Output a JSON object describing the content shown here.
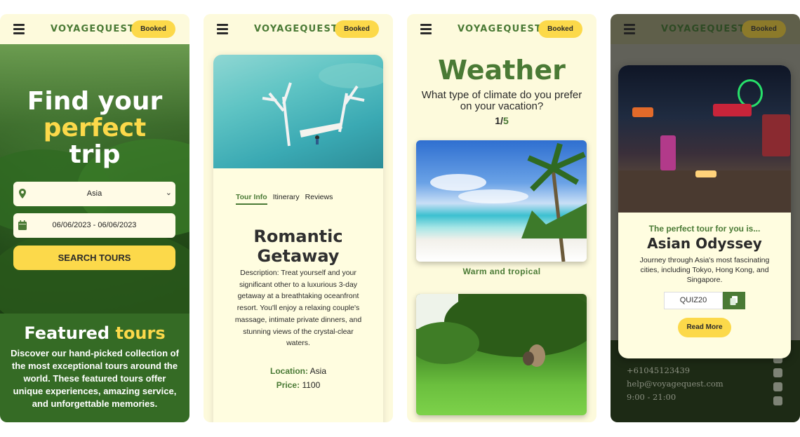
{
  "brand": {
    "logo": "VOYAGEQUEST",
    "booked_label": "Booked"
  },
  "panel1": {
    "hero_line1": "Find your",
    "hero_line2": "perfect",
    "hero_line3": "trip",
    "destination_value": "Asia",
    "date_value": "06/06/2023 - 06/06/2023",
    "search_label": "SEARCH TOURS",
    "featured_title_a": "Featured",
    "featured_title_b": "tours",
    "featured_text": "Discover our hand-picked collection of the most exceptional tours around the world. These featured tours offer unique experiences, amazing service, and unforgettable memories."
  },
  "panel2": {
    "tabs": [
      "Tour Info",
      "Itinerary",
      "Reviews"
    ],
    "title": "Romantic Getaway",
    "description": "Description: Treat yourself and your significant other to a luxurious 3-day getaway at a breathtaking oceanfront resort. You'll enjoy a relaxing couple's massage, intimate private dinners, and stunning views of the crystal-clear waters.",
    "location_label": "Location:",
    "location_value": "Asia",
    "price_label": "Price:",
    "price_value": "1100"
  },
  "panel3": {
    "title": "Weather",
    "question": "What type of climate do you prefer on your vacation?",
    "progress_current": "1/",
    "progress_total": "5",
    "option1_label": "Warm and tropical"
  },
  "panel4": {
    "subtitle": "The perfect tour for you is...",
    "title": "Asian Odyssey",
    "description": "Journey through Asia's most fascinating cities, including Tokyo, Hong Kong, and Singapore.",
    "code": "QUIZ20",
    "read_more": "Read More",
    "phone": "+61045123439",
    "email": "help@voyagequest.com",
    "hours": "9:00 - 21:00"
  },
  "colors": {
    "green": "#4a7a35",
    "yellow": "#fcd94a",
    "cream": "#fdfadc"
  }
}
